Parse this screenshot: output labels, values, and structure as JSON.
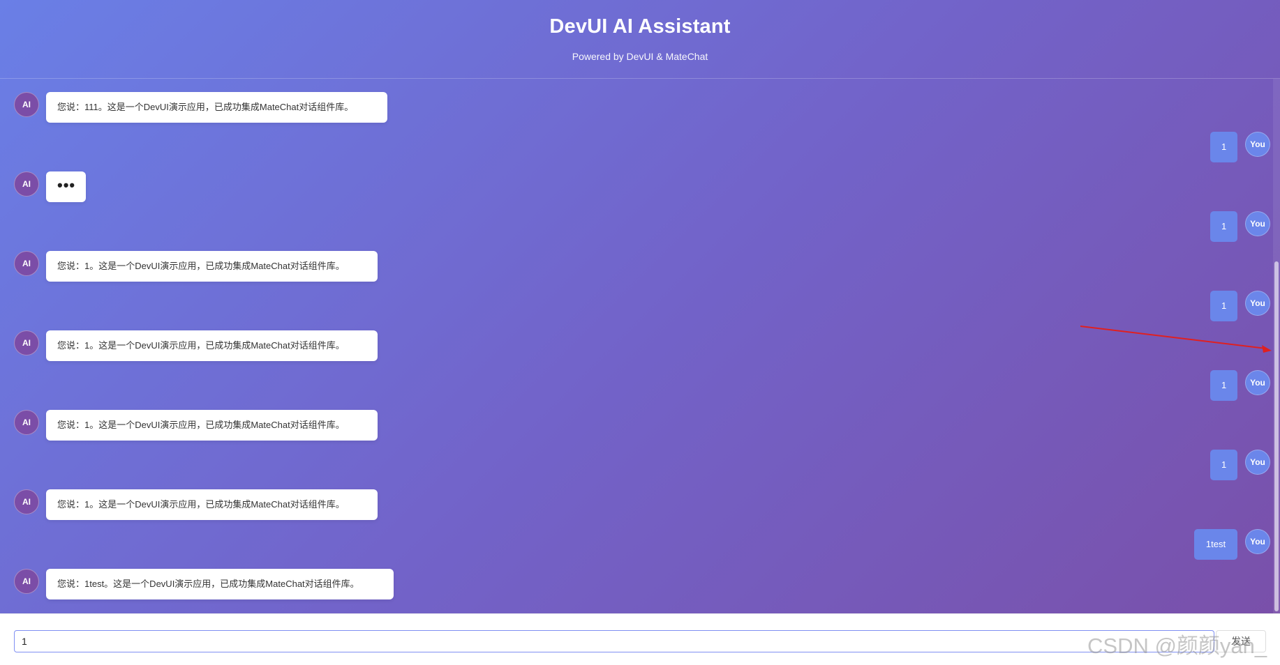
{
  "header": {
    "title": "DevUI AI Assistant",
    "subtitle": "Powered by DevUI & MateChat"
  },
  "avatars": {
    "ai": "AI",
    "user": "You"
  },
  "messages": [
    {
      "role": "ai",
      "text": "您说：111。这是一个DevUI演示应用，已成功集成MateChat对话组件库。"
    },
    {
      "role": "user",
      "text": "1"
    },
    {
      "role": "ai",
      "text": "•••"
    },
    {
      "role": "user",
      "text": "1"
    },
    {
      "role": "ai",
      "text": "您说：1。这是一个DevUI演示应用，已成功集成MateChat对话组件库。"
    },
    {
      "role": "user",
      "text": "1"
    },
    {
      "role": "ai",
      "text": "您说：1。这是一个DevUI演示应用，已成功集成MateChat对话组件库。"
    },
    {
      "role": "user",
      "text": "1"
    },
    {
      "role": "ai",
      "text": "您说：1。这是一个DevUI演示应用，已成功集成MateChat对话组件库。"
    },
    {
      "role": "user",
      "text": "1"
    },
    {
      "role": "ai",
      "text": "您说：1。这是一个DevUI演示应用，已成功集成MateChat对话组件库。"
    },
    {
      "role": "user",
      "text": "1test"
    },
    {
      "role": "ai",
      "text": "您说：1test。这是一个DevUI演示应用，已成功集成MateChat对话组件库。"
    }
  ],
  "composer": {
    "input_value": "1",
    "send_label": "发送"
  },
  "watermark": "CSDN @颜颜yan_",
  "colors": {
    "gradient_start": "#6a7fe6",
    "gradient_end": "#7a4fa8",
    "ai_avatar": "#7b4da7",
    "user_bubble": "#6a86ea",
    "annotation_arrow": "#e02020"
  }
}
